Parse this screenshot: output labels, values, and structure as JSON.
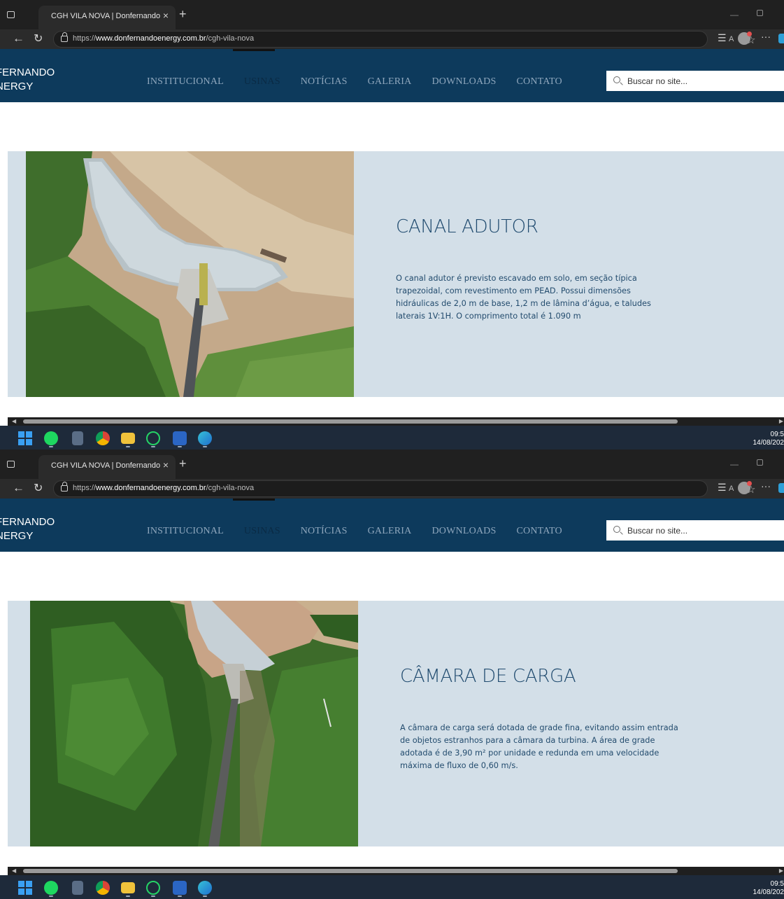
{
  "browser": {
    "tab_title": "CGH VILA NOVA | Donfernando",
    "tab_close": "×",
    "new_tab": "+",
    "url_scheme": "https://",
    "url_host": "www.donfernandoenergy.com.br",
    "url_path": "/cgh-vila-nova",
    "read_aloud": "A",
    "favorite": "☆",
    "collections": "⋮",
    "more": "···"
  },
  "site": {
    "logo_line1": "FERNANDO",
    "logo_line2": "NERGY",
    "menu": [
      {
        "label": "INSTITUCIONAL"
      },
      {
        "label": "USINAS"
      },
      {
        "label": "NOTÍCIAS"
      },
      {
        "label": "GALERIA"
      },
      {
        "label": "DOWNLOADS"
      },
      {
        "label": "CONTATO"
      }
    ],
    "active_menu": "USINAS",
    "search_placeholder": "Buscar no site...",
    "brand_color": "#0d3a5c",
    "section_bg": "#d3dfe8"
  },
  "sections": [
    {
      "title": "CANAL ADUTOR",
      "body": "O canal adutor é previsto escavado em solo, em seção típica trapezoidal, com revestimento em PEAD. Possui dimensões hidráulicas de 2,0 m de base, 1,2 m de lâmina d’água, e taludes laterais 1V:1H. O comprimento total é 1.090 m"
    },
    {
      "title": "CÂMARA DE CARGA",
      "body": "A câmara de carga será dotada de grade fina, evitando assim entrada de objetos estranhos para a câmara da turbina. A área de grade adotada é de 3,90 m² por unidade e redunda em uma velocidade máxima de fluxo de 0,60 m/s."
    }
  ],
  "taskbar": {
    "time": "09:5",
    "date": "14/08/202",
    "apps": [
      "start-icon",
      "spotify-icon",
      "calculator-icon",
      "chrome-icon",
      "file-explorer-icon",
      "whatsapp-icon",
      "word-icon",
      "edge-icon"
    ]
  }
}
